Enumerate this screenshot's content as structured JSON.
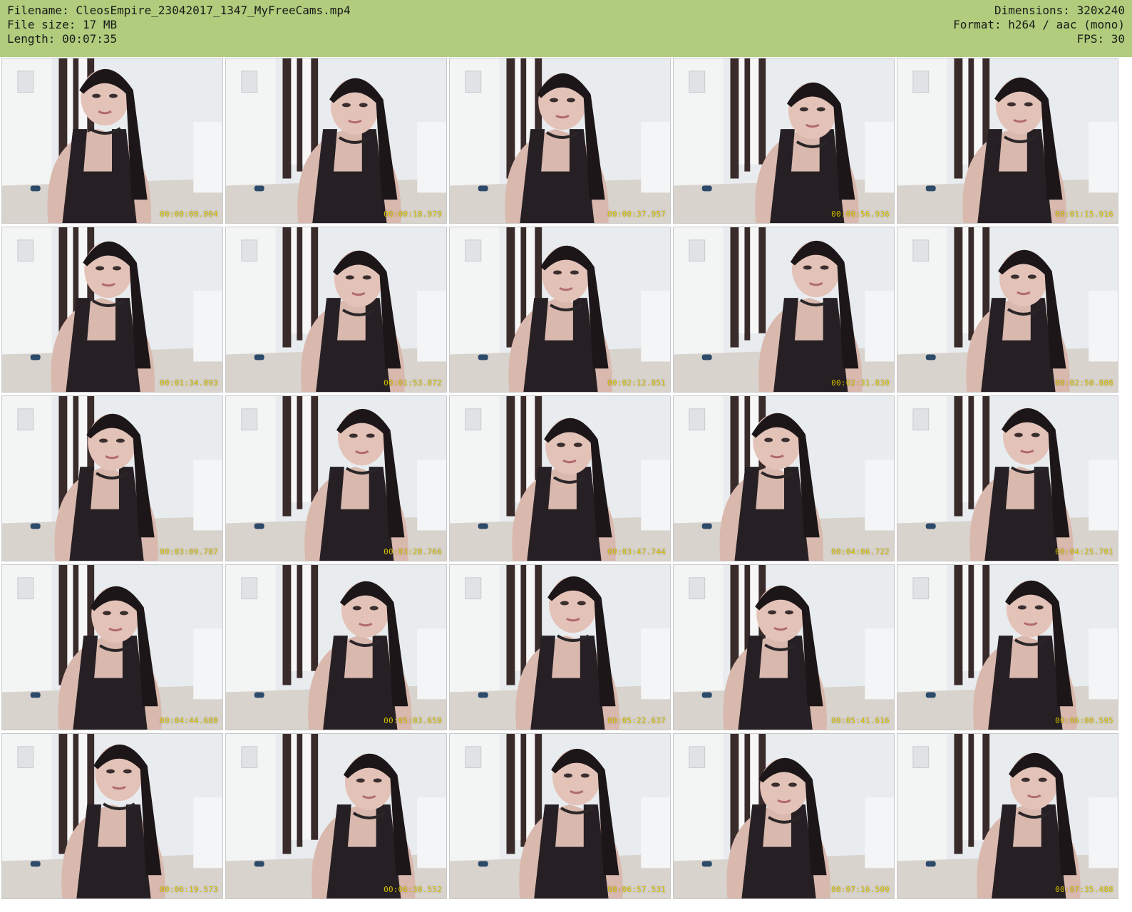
{
  "header": {
    "filename_line": "Filename: CleosEmpire_23042017_1347_MyFreeCams.mp4",
    "filesize_line": "File size: 17 MB",
    "length_line": "Length: 00:07:35",
    "dimensions_line": "Dimensions: 320x240",
    "format_line": "Format: h264 / aac (mono)",
    "fps_line": "FPS: 30"
  },
  "colors": {
    "header_bg": "#b0cc7c",
    "timestamp": "#d8c200"
  },
  "thumbnails": [
    {
      "timestamp": "00:00:00.004"
    },
    {
      "timestamp": "00:00:18.979"
    },
    {
      "timestamp": "00:00:37.957"
    },
    {
      "timestamp": "00:00:56.936"
    },
    {
      "timestamp": "00:01:15.916"
    },
    {
      "timestamp": "00:01:34.893"
    },
    {
      "timestamp": "00:01:53.872"
    },
    {
      "timestamp": "00:02:12.851"
    },
    {
      "timestamp": "00:02:31.830"
    },
    {
      "timestamp": "00:02:50.808"
    },
    {
      "timestamp": "00:03:09.787"
    },
    {
      "timestamp": "00:03:28.766"
    },
    {
      "timestamp": "00:03:47.744"
    },
    {
      "timestamp": "00:04:06.722"
    },
    {
      "timestamp": "00:04:25.701"
    },
    {
      "timestamp": "00:04:44.680"
    },
    {
      "timestamp": "00:05:03.659"
    },
    {
      "timestamp": "00:05:22.637"
    },
    {
      "timestamp": "00:05:41.616"
    },
    {
      "timestamp": "00:06:00.595"
    },
    {
      "timestamp": "00:06:19.573"
    },
    {
      "timestamp": "00:06:38.552"
    },
    {
      "timestamp": "00:06:57.531"
    },
    {
      "timestamp": "00:07:16.509"
    },
    {
      "timestamp": "00:07:35.488"
    }
  ]
}
